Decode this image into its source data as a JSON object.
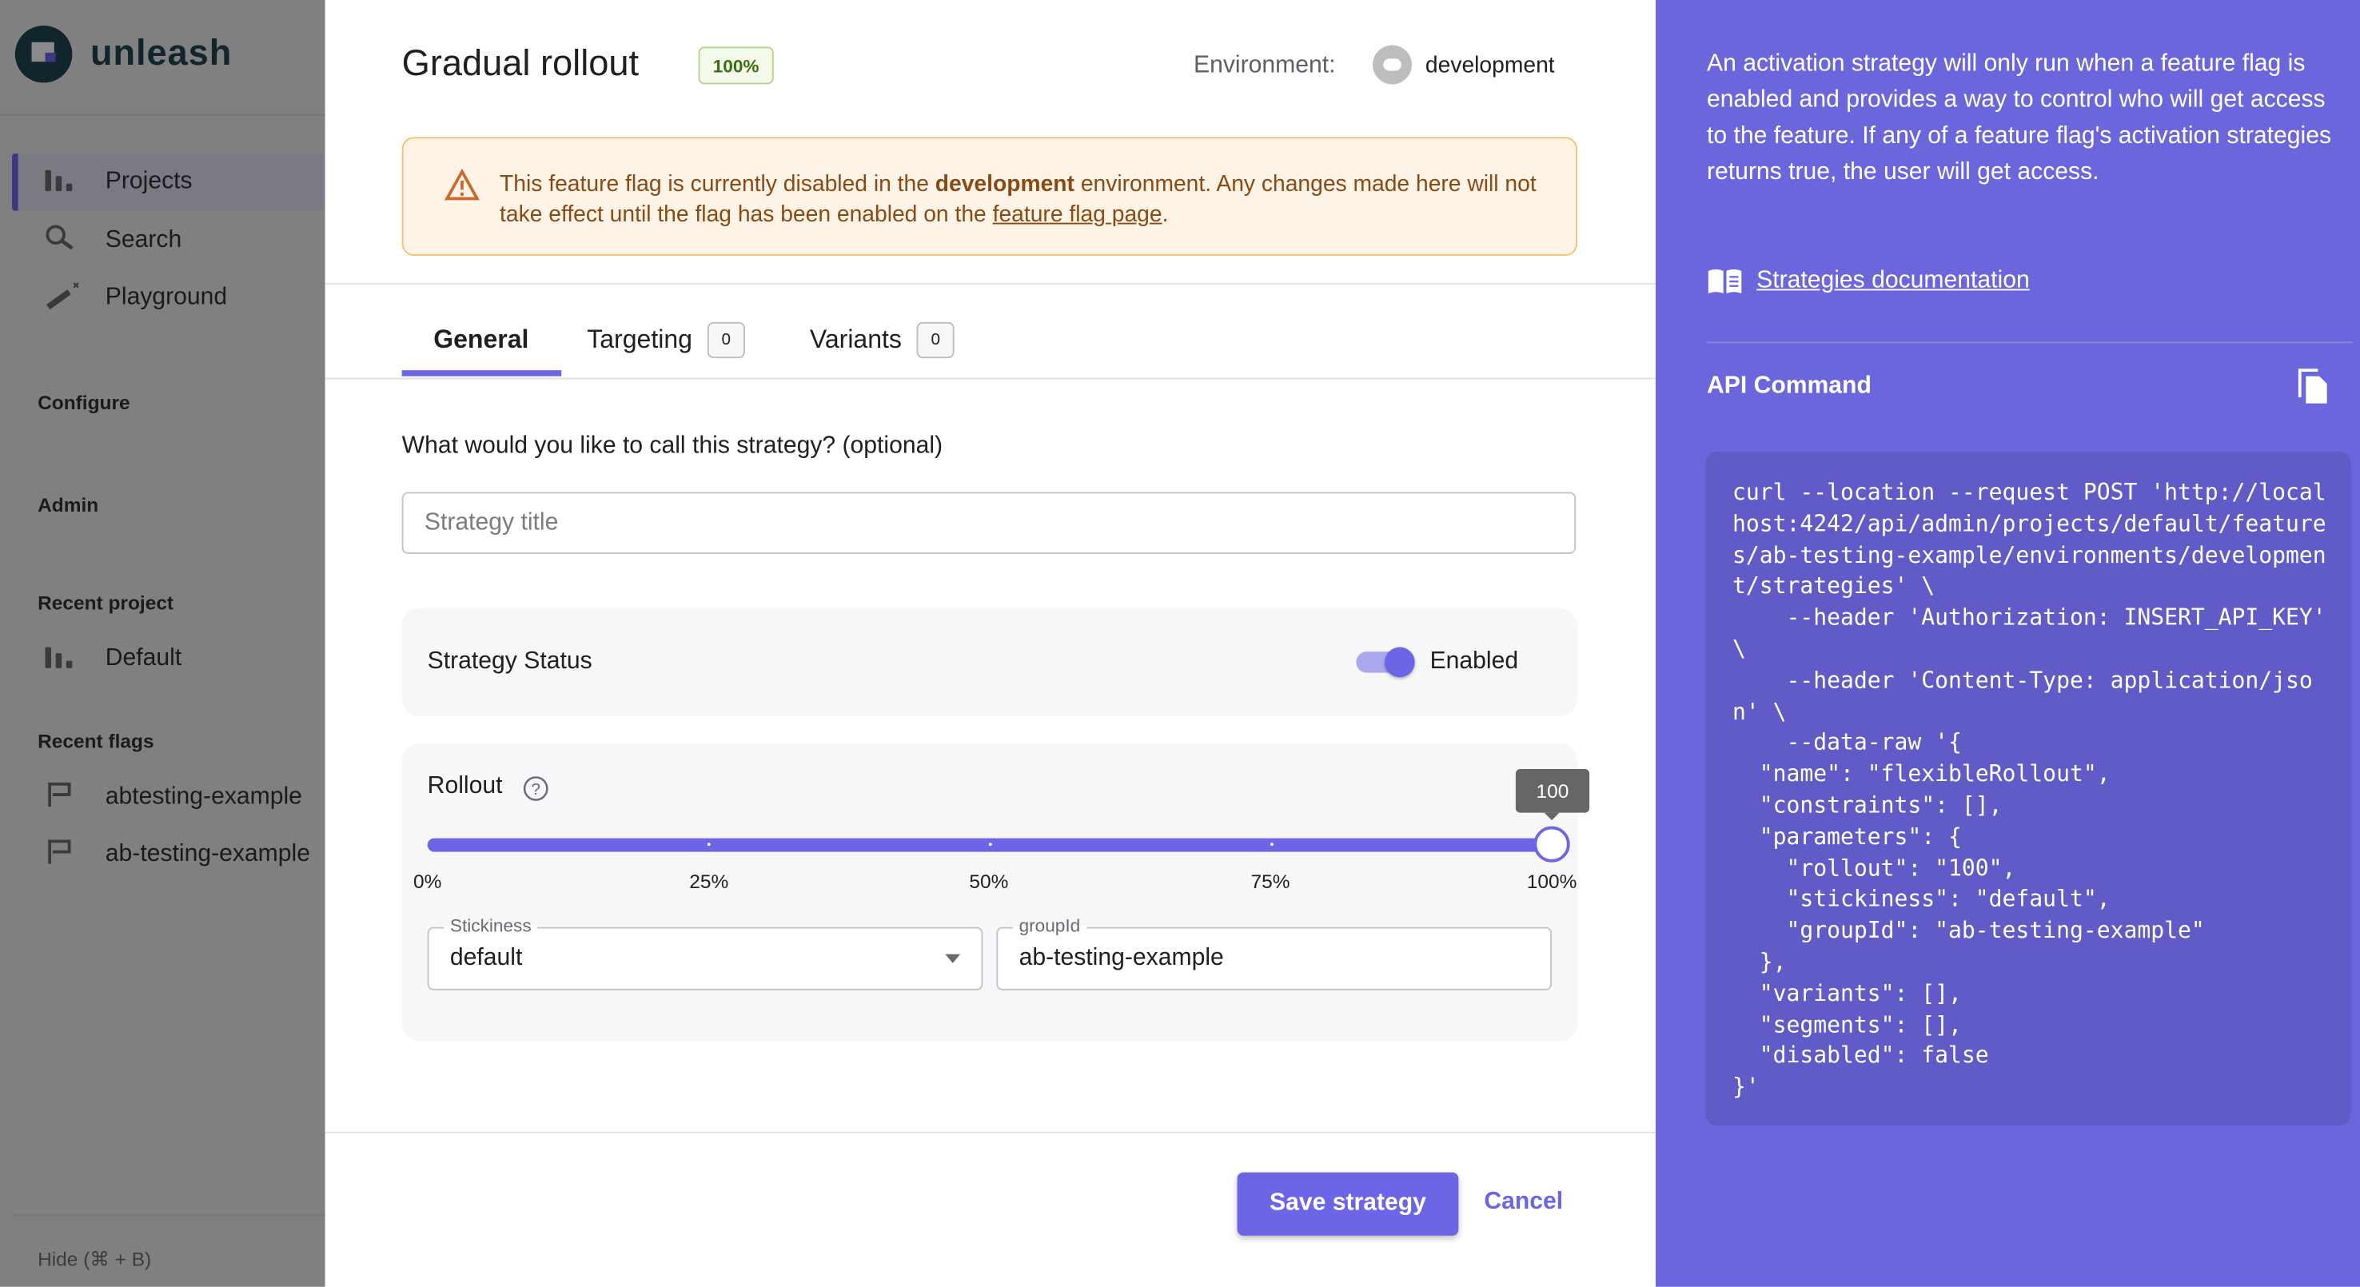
{
  "sidebar": {
    "logo_text": "unleash",
    "nav": [
      {
        "label": "Projects",
        "icon": "projects-icon",
        "active": true
      },
      {
        "label": "Search",
        "icon": "search-icon"
      },
      {
        "label": "Playground",
        "icon": "playground-wand-icon"
      }
    ],
    "configure": "Configure",
    "admin": "Admin",
    "recent_project_heading": "Recent project",
    "recent_project": "Default",
    "recent_flags_heading": "Recent flags",
    "recent_flags": [
      "abtesting-example",
      "ab-testing-example"
    ],
    "hide": "Hide (⌘ + B)"
  },
  "main": {
    "title": "Gradual rollout",
    "badge": "100%",
    "environment_label": "Environment:",
    "environment": "development",
    "alert": {
      "pre": "This feature flag is currently disabled in the ",
      "bold": "development",
      "mid": " environment. Any changes made here will not take effect until the flag has been enabled on the ",
      "link": "feature flag page",
      "post": "."
    },
    "tabs": [
      {
        "label": "General",
        "active": true
      },
      {
        "label": "Targeting",
        "count": "0"
      },
      {
        "label": "Variants",
        "count": "0"
      }
    ],
    "question": "What would you like to call this strategy? (optional)",
    "title_input": {
      "value": "",
      "placeholder": "Strategy title"
    },
    "status_label": "Strategy Status",
    "status_value": "Enabled",
    "status_enabled": true,
    "rollout_label": "Rollout",
    "rollout_value": 100,
    "rollout_tooltip": "100",
    "rollout_ticks": [
      "0%",
      "25%",
      "50%",
      "75%",
      "100%"
    ],
    "stickiness": {
      "label": "Stickiness",
      "value": "default"
    },
    "groupid": {
      "label": "groupId",
      "value": "ab-testing-example"
    },
    "save": "Save strategy",
    "cancel": "Cancel"
  },
  "right": {
    "description": "An activation strategy will only run when a feature flag is enabled and provides a way to control who will get access to the feature. If any of a feature flag's activation strategies returns true, the user will get access.",
    "doc_link": "Strategies documentation",
    "api_heading": "API Command",
    "code": "curl --location --request POST 'http://local\nhost:4242/api/admin/projects/default/feature\ns/ab-testing-example/environments/developmen\nt/strategies' \\\n    --header 'Authorization: INSERT_API_KEY'\n\\\n    --header 'Content-Type: application/jso\nn' \\\n    --data-raw '{\n  \"name\": \"flexibleRollout\",\n  \"constraints\": [],\n  \"parameters\": {\n    \"rollout\": \"100\",\n    \"stickiness\": \"default\",\n    \"groupId\": \"ab-testing-example\"\n  },\n  \"variants\": [],\n  \"segments\": [],\n  \"disabled\": false\n}'"
  },
  "colors": {
    "accent": "#6c65e5",
    "side_panel": "#6b66dc",
    "warning_bg": "#fdf3e6",
    "warning_text": "#8a4a14",
    "badge_green": "#3b6e0e"
  }
}
